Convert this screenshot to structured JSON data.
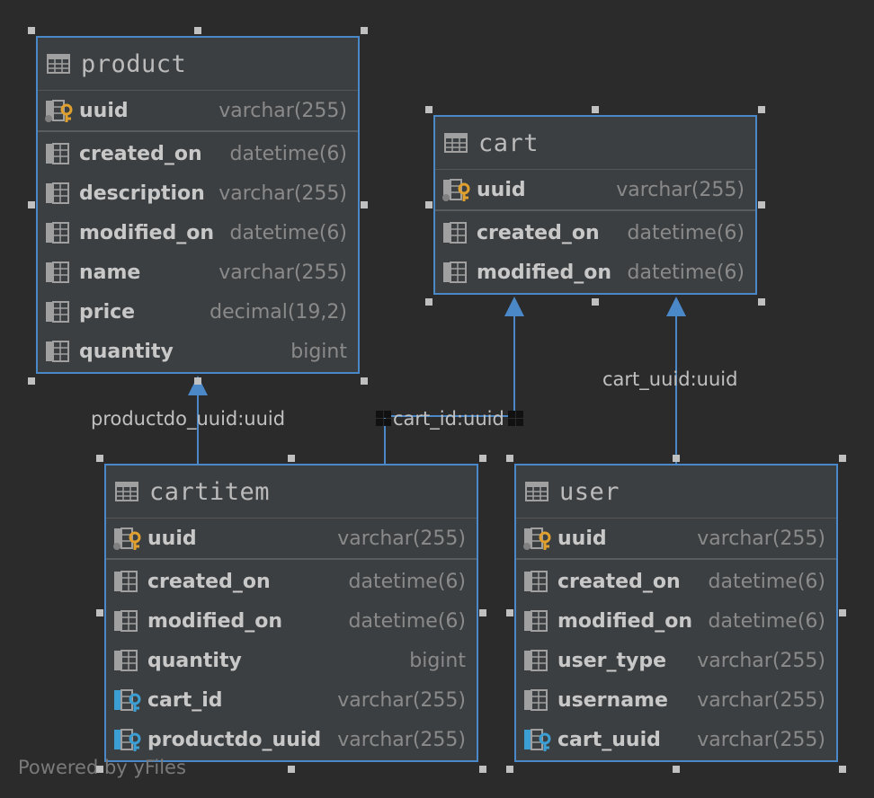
{
  "tables": {
    "product": {
      "name": "product",
      "pk": {
        "name": "uuid",
        "type": "varchar(255)",
        "icon": "primary-key-icon"
      },
      "columns": [
        {
          "name": "created_on",
          "type": "datetime(6)",
          "icon": "column-icon"
        },
        {
          "name": "description",
          "type": "varchar(255)",
          "icon": "column-icon"
        },
        {
          "name": "modified_on",
          "type": "datetime(6)",
          "icon": "column-icon"
        },
        {
          "name": "name",
          "type": "varchar(255)",
          "icon": "column-icon"
        },
        {
          "name": "price",
          "type": "decimal(19,2)",
          "icon": "column-icon"
        },
        {
          "name": "quantity",
          "type": "bigint",
          "icon": "column-icon"
        }
      ]
    },
    "cart": {
      "name": "cart",
      "pk": {
        "name": "uuid",
        "type": "varchar(255)",
        "icon": "primary-key-icon"
      },
      "columns": [
        {
          "name": "created_on",
          "type": "datetime(6)",
          "icon": "column-icon"
        },
        {
          "name": "modified_on",
          "type": "datetime(6)",
          "icon": "column-icon"
        }
      ]
    },
    "cartitem": {
      "name": "cartitem",
      "pk": {
        "name": "uuid",
        "type": "varchar(255)",
        "icon": "primary-key-icon"
      },
      "columns": [
        {
          "name": "created_on",
          "type": "datetime(6)",
          "icon": "column-icon"
        },
        {
          "name": "modified_on",
          "type": "datetime(6)",
          "icon": "column-icon"
        },
        {
          "name": "quantity",
          "type": "bigint",
          "icon": "column-icon"
        },
        {
          "name": "cart_id",
          "type": "varchar(255)",
          "icon": "foreign-key-icon"
        },
        {
          "name": "productdo_uuid",
          "type": "varchar(255)",
          "icon": "foreign-key-icon"
        }
      ]
    },
    "user": {
      "name": "user",
      "pk": {
        "name": "uuid",
        "type": "varchar(255)",
        "icon": "primary-key-icon"
      },
      "columns": [
        {
          "name": "created_on",
          "type": "datetime(6)",
          "icon": "column-icon"
        },
        {
          "name": "modified_on",
          "type": "datetime(6)",
          "icon": "column-icon"
        },
        {
          "name": "user_type",
          "type": "varchar(255)",
          "icon": "column-icon"
        },
        {
          "name": "username",
          "type": "varchar(255)",
          "icon": "column-icon"
        },
        {
          "name": "cart_uuid",
          "type": "varchar(255)",
          "icon": "foreign-key-icon"
        }
      ]
    }
  },
  "relations": {
    "productdo": "productdo_uuid:uuid",
    "cart_id": "cart_id:uuid",
    "cart_uuid": "cart_uuid:uuid"
  },
  "footer": "Powered by yFiles",
  "colors": {
    "background": "#2b2b2b",
    "table_bg": "#3c3f41",
    "border_accent": "#4a88c7",
    "pk_key": "#e0a030",
    "fk_key": "#3b9fd4"
  }
}
